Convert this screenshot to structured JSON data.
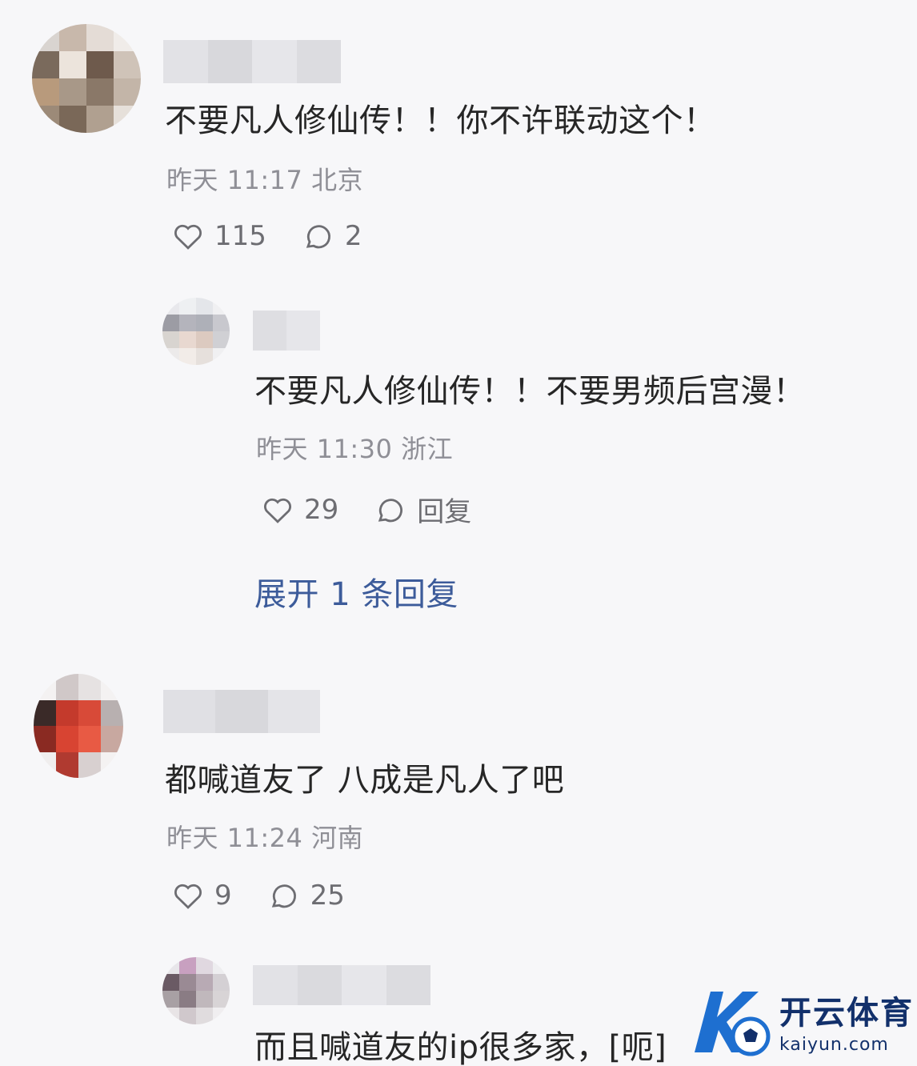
{
  "comments": [
    {
      "text": "不要凡人修仙传！！你不许联动这个！",
      "meta": "昨天 11:17 北京",
      "likes": "115",
      "replies": "2",
      "reply": {
        "text": "不要凡人修仙传！！不要男频后宫漫！",
        "meta": "昨天 11:30 浙江",
        "likes": "29",
        "reply_label": "回复"
      },
      "expand_label": "展开 1 条回复"
    },
    {
      "text": "都喊道友了 八成是凡人了吧",
      "meta": "昨天 11:24 河南",
      "likes": "9",
      "replies": "25",
      "reply": {
        "text": "而且喊道友的ip很多家，[呃]"
      }
    }
  ],
  "icons": {
    "like": "heart-outline-icon",
    "comment": "speech-bubble-icon"
  },
  "watermark": {
    "cn": "开云体育",
    "en": "kaiyun.com"
  },
  "colors": {
    "background": "#f7f7f9",
    "meta": "#8f8f96",
    "link": "#3c5b9a",
    "watermark": "#12306b"
  }
}
